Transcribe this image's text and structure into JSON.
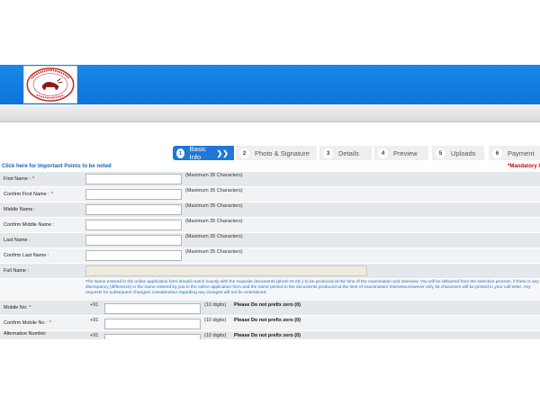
{
  "header": {
    "logo_name": "emblem-logo",
    "logo_text": "ONE CO-OPERATIVE BANK LTD · ESTD 1914"
  },
  "steps": [
    {
      "num": "1",
      "label": "Basic Info",
      "active": true
    },
    {
      "num": "2",
      "label": "Photo & Signature",
      "active": false
    },
    {
      "num": "3",
      "label": "Details",
      "active": false
    },
    {
      "num": "4",
      "label": "Preview",
      "active": false
    },
    {
      "num": "5",
      "label": "Uploads",
      "active": false
    },
    {
      "num": "6",
      "label": "Payment",
      "active": false
    }
  ],
  "links": {
    "important_points": "Click here for Important Points to be noted",
    "mandatory": "*Mandatory I"
  },
  "form": {
    "rows": [
      {
        "label": "First Name :",
        "required": "*",
        "hint": "(Maximum 35 Characters)"
      },
      {
        "label": "Confirm First Name :",
        "required": "*",
        "hint": "(Maximum 35 Characters)"
      },
      {
        "label": "Middle Name :",
        "required": "",
        "hint": "(Maximum 35 Characters)"
      },
      {
        "label": "Confirm Middle Name :",
        "required": "",
        "hint": "(Maximum 35 Characters)"
      },
      {
        "label": "Last Name :",
        "required": "",
        "hint": "(Maximum 35 Characters)"
      },
      {
        "label": "Confirm Last Name :",
        "required": "",
        "hint": "(Maximum 35 Characters)"
      }
    ],
    "full_name_label": "Full Name :",
    "note": "The Name entered in the online application form should match exactly with the requisite documents (photo ID etc.) to be produced at the time of the examination and interview. You will be debarred from the selection process, if there is any discrepancy (difference) in the name entered by you in the online application form and the name printed in the documents produced at the time of examination/ interview.However only 35 characters will be printed in your call letter. Any requests for subsequent changes/ consideration regarding any changes will not be entertained.",
    "mobile_rows": [
      {
        "label": "Mobile No:",
        "required": "*",
        "prefix": "+91",
        "digits": "(10 digits)",
        "warning": "Please Do not prefix zero (0)"
      },
      {
        "label": "Confirm Mobile No :",
        "required": "*",
        "prefix": "+91",
        "digits": "(10 digits)",
        "warning": "Please Do not prefix zero (0)"
      },
      {
        "label": "Alternative Number",
        "required": "",
        "prefix": "+91",
        "digits": "(10 digits)",
        "warning": "Please Do not prefix zero (0)"
      }
    ]
  }
}
